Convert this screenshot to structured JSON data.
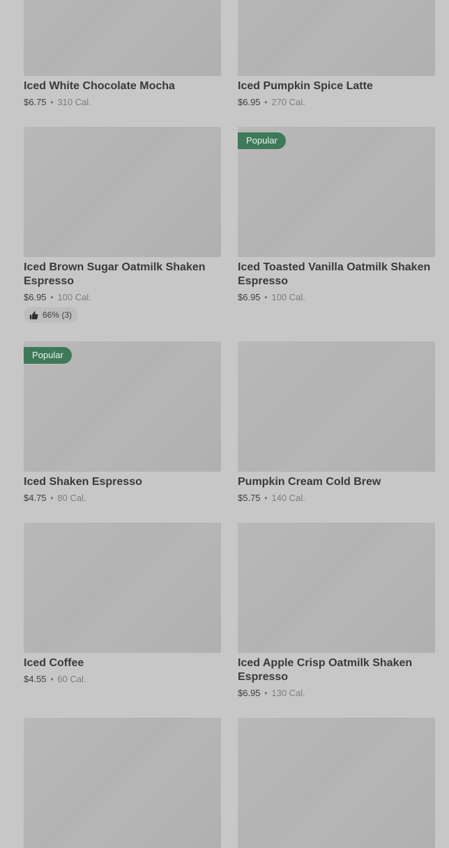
{
  "products": [
    {
      "name": "Iced White Chocolate Mocha",
      "price": "$6.75",
      "calories": "310 Cal.",
      "badge": "",
      "rating": ""
    },
    {
      "name": "Iced Pumpkin Spice Latte",
      "price": "$6.95",
      "calories": "270 Cal.",
      "badge": "",
      "rating": ""
    },
    {
      "name": "Iced Brown Sugar Oatmilk Shaken Espresso",
      "price": "$6.95",
      "calories": "100 Cal.",
      "badge": "",
      "rating": "66% (3)"
    },
    {
      "name": "Iced Toasted Vanilla Oatmilk Shaken Espresso",
      "price": "$6.95",
      "calories": "100 Cal.",
      "badge": "Popular",
      "rating": ""
    },
    {
      "name": "Iced Shaken Espresso",
      "price": "$4.75",
      "calories": "80 Cal.",
      "badge": "Popular",
      "rating": ""
    },
    {
      "name": "Pumpkin Cream Cold Brew",
      "price": "$5.75",
      "calories": "140 Cal.",
      "badge": "",
      "rating": ""
    },
    {
      "name": "Iced Coffee",
      "price": "$4.55",
      "calories": "60 Cal.",
      "badge": "",
      "rating": ""
    },
    {
      "name": "Iced Apple Crisp Oatmilk Shaken Espresso",
      "price": "$6.95",
      "calories": "130 Cal.",
      "badge": "",
      "rating": ""
    },
    {
      "name": "",
      "price": "",
      "calories": "",
      "badge": "",
      "rating": ""
    },
    {
      "name": "",
      "price": "",
      "calories": "",
      "badge": "",
      "rating": ""
    }
  ],
  "separator": "•",
  "colors": {
    "background": "#c7c7c7",
    "badge_bg": "#3d7a5a",
    "badge_text": "#eef2ef",
    "thumbnail": "#b5b5b5"
  },
  "icons": {
    "rating": "thumbs-up-icon"
  }
}
